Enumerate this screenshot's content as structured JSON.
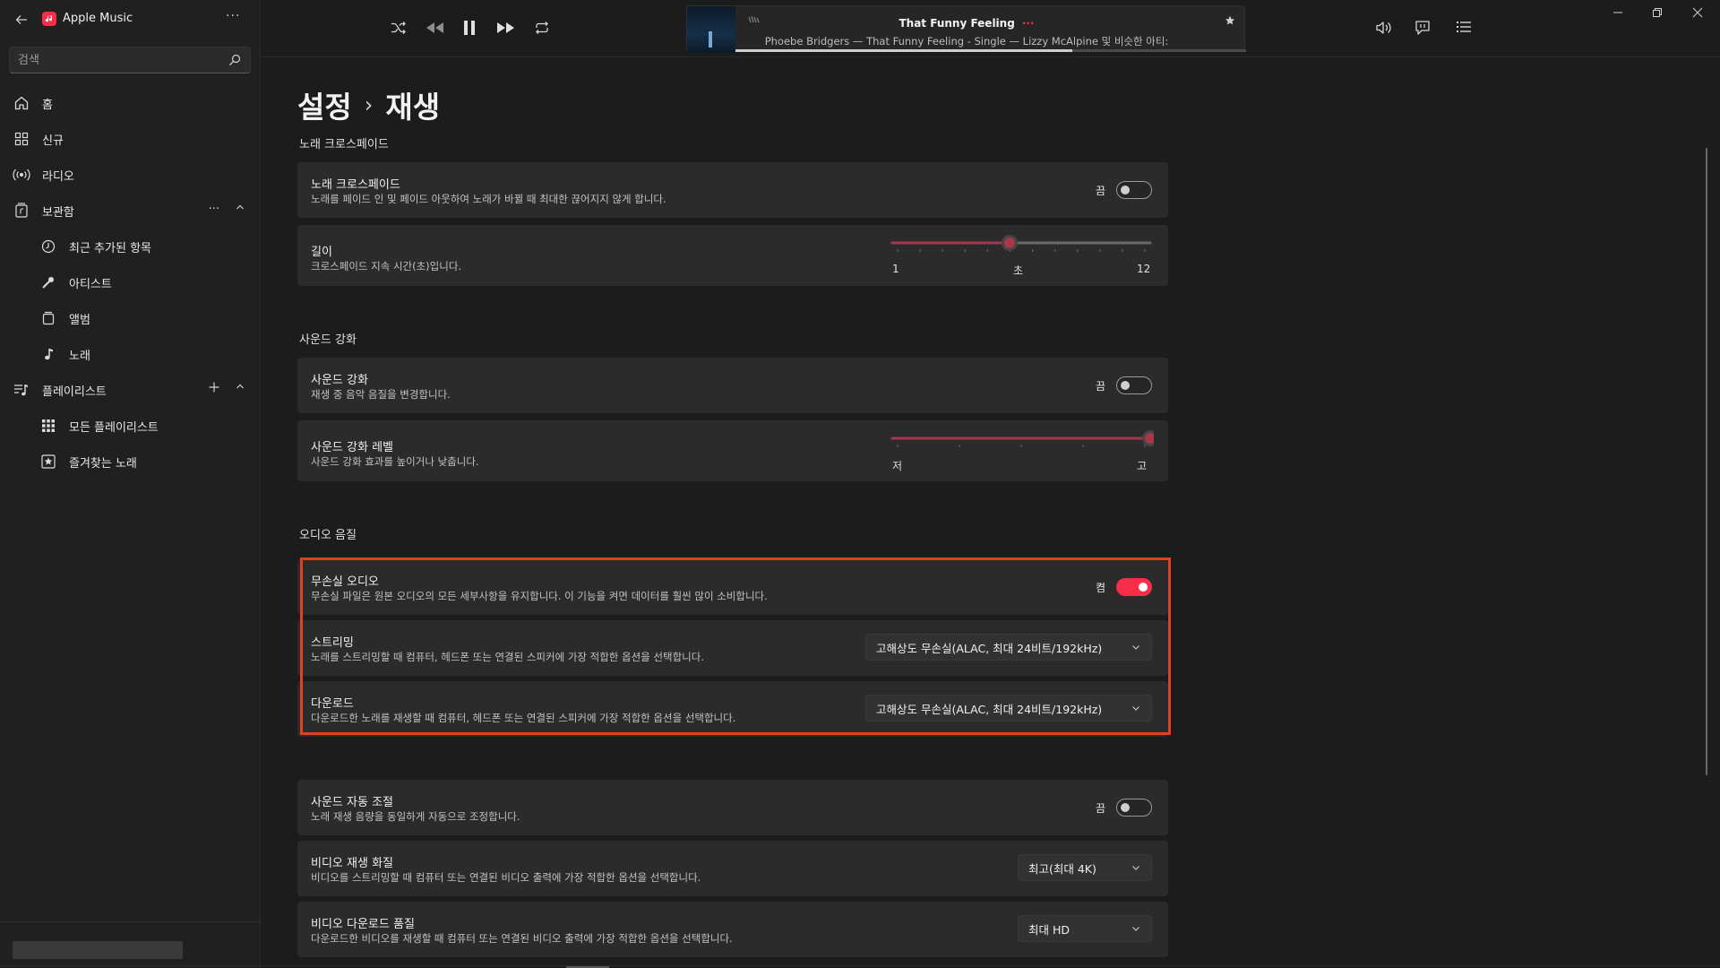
{
  "app": {
    "title": "Apple Music",
    "more_label": "···",
    "accent": "#fa2d48"
  },
  "search": {
    "placeholder": "검색"
  },
  "sidebar": {
    "items": [
      {
        "label": "홈",
        "icon": "home-icon"
      },
      {
        "label": "신규",
        "icon": "grid-icon"
      },
      {
        "label": "라디오",
        "icon": "radio-icon"
      },
      {
        "label": "보관함",
        "icon": "library-icon",
        "more": "···"
      },
      {
        "label": "최근 추가된 항목",
        "icon": "clock-icon"
      },
      {
        "label": "아티스트",
        "icon": "microphone-icon"
      },
      {
        "label": "앨범",
        "icon": "album-icon"
      },
      {
        "label": "노래",
        "icon": "music-note-icon"
      },
      {
        "label": "플레이리스트",
        "icon": "playlist-icon"
      },
      {
        "label": "모든 플레이리스트",
        "icon": "playlists-grid-icon"
      },
      {
        "label": "즐겨찾는 노래",
        "icon": "star-box-icon"
      }
    ]
  },
  "player": {
    "title": "That Funny Feeling",
    "title_more": "···",
    "subtitle": "Phoebe Bridgers — That Funny Feeling - Single — Lizzy McAlpine 및 비슷한 아티:",
    "progress": 0.66
  },
  "page": {
    "breadcrumb_parent": "설정",
    "breadcrumb_sep": "›",
    "title": "재생"
  },
  "crossfade": {
    "section": "노래 크로스페이드",
    "toggle": {
      "title": "노래 크로스페이드",
      "desc": "노래를 페이드 인 및 페이드 아웃하여 노래가 바뀔 때 최대한 끊어지지 않게 합니다.",
      "state_label": "끔",
      "on": false
    },
    "length": {
      "title": "길이",
      "desc": "크로스페이드 지속 시간(초)입니다.",
      "min_label": "1",
      "unit_label": "초",
      "max_label": "12",
      "min": 1,
      "max": 12,
      "value": 6
    }
  },
  "sound": {
    "section": "사운드 강화",
    "toggle": {
      "title": "사운드 강화",
      "desc": "재생 중 음악 음질을 변경합니다.",
      "state_label": "끔",
      "on": false
    },
    "level": {
      "title": "사운드 강화 레벨",
      "desc": "사운드 강화 효과를 높이거나 낮춥니다.",
      "low_label": "저",
      "high_label": "고",
      "value": 1.0
    }
  },
  "audio": {
    "section": "오디오 음질",
    "lossless": {
      "title": "무손실 오디오",
      "desc": "무손실 파일은 원본 오디오의 모든 세부사항을 유지합니다. 이 기능을 켜면 데이터를 훨씬 많이 소비합니다.",
      "state_label": "켬",
      "on": true
    },
    "streaming": {
      "title": "스트리밍",
      "desc": "노래를 스트리밍할 때 컴퓨터, 헤드폰 또는 연결된 스피커에 가장 적합한 옵션을 선택합니다.",
      "value": "고해상도 무손실(ALAC, 최대 24비트/192kHz)"
    },
    "download": {
      "title": "다운로드",
      "desc": "다운로드한 노래를 재생할 때 컴퓨터, 헤드폰 또는 연결된 스피커에 가장 적합한 옵션을 선택합니다.",
      "value": "고해상도 무손실(ALAC, 최대 24비트/192kHz)"
    }
  },
  "other": {
    "auto_volume": {
      "title": "사운드 자동 조절",
      "desc": "노래 재생 음량을 동일하게 자동으로 조정합니다.",
      "state_label": "끔",
      "on": false
    },
    "video_quality": {
      "title": "비디오 재생 화질",
      "desc": "비디오를 스트리밍할 때 컴퓨터 또는 연결된 비디오 출력에 가장 적합한 옵션을 선택합니다.",
      "value": "최고(최대 4K)"
    },
    "video_download": {
      "title": "비디오 다운로드 품질",
      "desc": "다운로드한 비디오를 재생할 때 컴퓨터 또는 연결된 비디오 출력에 가장 적합한 옵션을 선택합니다.",
      "value": "최대 HD"
    }
  }
}
